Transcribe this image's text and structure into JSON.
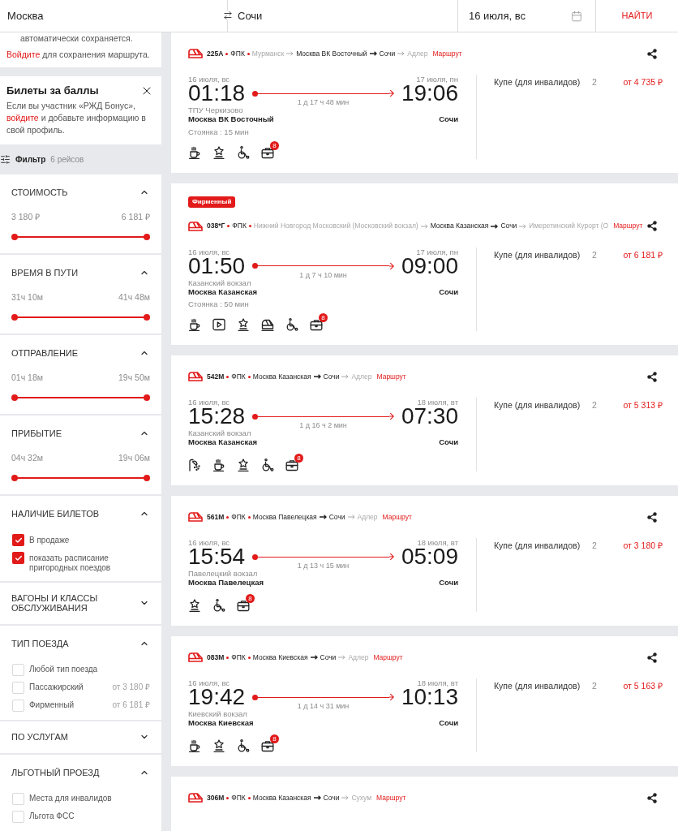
{
  "search": {
    "from": "Москва",
    "to": "Сочи",
    "date": "16 июля, вс",
    "submit": "НАЙТИ"
  },
  "sidebar": {
    "save_note": {
      "text": "автоматически сохраняется.",
      "link": "Войдите",
      "rest": "для сохранения маршрута."
    },
    "bonus": {
      "title": "Билеты за баллы",
      "before": "Если вы участник «РЖД Бонус»,",
      "link": "войдите",
      "after": "и добавьте информацию в свой профиль."
    },
    "filter": {
      "label": "Фильтр",
      "count": "6 рейсов"
    },
    "sections": [
      {
        "kind": "range",
        "title": "СТОИМОСТЬ",
        "expanded": true,
        "min": "3 180 ₽",
        "max": "6 181 ₽",
        "level": 1
      },
      {
        "kind": "range",
        "title": "ВРЕМЯ В ПУТИ",
        "expanded": true,
        "min": "31ч 10м",
        "max": "41ч 48м",
        "level": 1
      },
      {
        "kind": "range",
        "title": "ОТПРАВЛЕНИЕ",
        "expanded": true,
        "min": "01ч 18м",
        "max": "19ч 50м",
        "level": 1
      },
      {
        "kind": "range",
        "title": "ПРИБЫТИЕ",
        "expanded": true,
        "min": "04ч 32м",
        "max": "19ч 06м",
        "level": 1
      },
      {
        "kind": "checklist",
        "title": "НАЛИЧИЕ БИЛЕТОВ",
        "expanded": true,
        "options": [
          {
            "label": "В продаже",
            "checked": true
          },
          {
            "label": "показать расписание пригородных поездов",
            "checked": true
          }
        ]
      },
      {
        "kind": "checklist",
        "title": "ВАГОНЫ И КЛАССЫ ОБСЛУЖИВАНИЯ",
        "expanded": false
      },
      {
        "kind": "checklist",
        "title": "ТИП ПОЕЗДА",
        "expanded": true,
        "options": [
          {
            "label": "Любой тип поезда",
            "checked": false
          },
          {
            "label": "Пассажирский",
            "price": "от 3 180 ₽",
            "checked": false
          },
          {
            "label": "Фирменный",
            "price": "от 6 181 ₽",
            "checked": false
          }
        ]
      },
      {
        "kind": "checklist",
        "title": "ПО УСЛУГАМ",
        "expanded": false
      },
      {
        "kind": "checklist",
        "title": "ЛЬГОТНЫЙ ПРОЕЗД",
        "expanded": true,
        "options": [
          {
            "label": "Места для инвалидов",
            "checked": false
          },
          {
            "label": "Льгота ФСС",
            "checked": false
          }
        ]
      }
    ]
  },
  "trains": [
    {
      "number": "225А",
      "carrier": "ФПК",
      "route": [
        {
          "name": "Мурманск",
          "active": false
        },
        {
          "name": "Москва ВК Восточный",
          "active": true
        },
        {
          "name": "Сочи",
          "active": true
        },
        {
          "name": "Адлер",
          "active": false
        }
      ],
      "route_link": "Маршрут",
      "departure": {
        "date": "16 июля, вс",
        "time": "01:18",
        "station": "ТПУ Черкизово",
        "city": "Москва ВК Восточный"
      },
      "arrival": {
        "date": "17 июля, пн",
        "time": "19:06",
        "city": "Сочи"
      },
      "duration": "1 д 17 ч 48 мин",
      "stop": "Стоянка : 15 мин",
      "amenities": [
        {
          "kind": "coffee"
        },
        {
          "kind": "star"
        },
        {
          "kind": "wheelchair"
        },
        {
          "kind": "case",
          "badge": "8"
        }
      ],
      "fares": [
        {
          "class": "Купе (для инвалидов)",
          "seats": "2",
          "price": "от 4 735 ₽"
        }
      ]
    },
    {
      "badge": "Фирменный",
      "number": "038*Г",
      "carrier": "ФПК",
      "route": [
        {
          "name": "Нижний Новгород Московский (Московский вокзал)",
          "active": false
        },
        {
          "name": "Москва Казанская",
          "active": true
        },
        {
          "name": "Сочи",
          "active": true
        },
        {
          "name": "Имеретинский Курорт (О",
          "active": false
        }
      ],
      "route_link": "Маршрут",
      "departure": {
        "date": "16 июля, вс",
        "time": "01:50",
        "station": "Казанский вокзал",
        "city": "Москва Казанская"
      },
      "arrival": {
        "date": "17 июля, пн",
        "time": "09:00",
        "city": "Сочи"
      },
      "duration": "1 д 7 ч 10 мин",
      "stop": "Стоянка : 50 мин",
      "amenities": [
        {
          "kind": "coffee"
        },
        {
          "kind": "video"
        },
        {
          "kind": "star"
        },
        {
          "kind": "train"
        },
        {
          "kind": "wheelchair"
        },
        {
          "kind": "case",
          "badge": "8"
        }
      ],
      "fares": [
        {
          "class": "Купе (для инвалидов)",
          "seats": "2",
          "price": "от 6 181 ₽"
        }
      ]
    },
    {
      "number": "542М",
      "carrier": "ФПК",
      "route": [
        {
          "name": "Москва Казанская",
          "active": true
        },
        {
          "name": "Сочи",
          "active": true
        },
        {
          "name": "Адлер",
          "active": false
        }
      ],
      "route_link": "Маршрут",
      "departure": {
        "date": "16 июля, вс",
        "time": "15:28",
        "station": "Казанский вокзал",
        "city": "Москва Казанская"
      },
      "arrival": {
        "date": "18 июля, вт",
        "time": "07:30",
        "city": "Сочи"
      },
      "duration": "1 д 16 ч 2 мин",
      "amenities": [
        {
          "kind": "shower"
        },
        {
          "kind": "coffee"
        },
        {
          "kind": "star"
        },
        {
          "kind": "wheelchair"
        },
        {
          "kind": "case",
          "badge": "8"
        }
      ],
      "fares": [
        {
          "class": "Купе (для инвалидов)",
          "seats": "2",
          "price": "от 5 313 ₽"
        }
      ]
    },
    {
      "number": "561М",
      "carrier": "ФПК",
      "route": [
        {
          "name": "Москва Павелецкая",
          "active": true
        },
        {
          "name": "Сочи",
          "active": true
        },
        {
          "name": "Адлер",
          "active": false
        }
      ],
      "route_link": "Маршрут",
      "departure": {
        "date": "16 июля, вс",
        "time": "15:54",
        "station": "Павелецкий вокзал",
        "city": "Москва Павелецкая"
      },
      "arrival": {
        "date": "18 июля, вт",
        "time": "05:09",
        "city": "Сочи"
      },
      "duration": "1 д 13 ч 15 мин",
      "amenities": [
        {
          "kind": "star"
        },
        {
          "kind": "wheelchair"
        },
        {
          "kind": "case",
          "badge": "8"
        }
      ],
      "fares": [
        {
          "class": "Купе (для инвалидов)",
          "seats": "2",
          "price": "от 3 180 ₽"
        }
      ]
    },
    {
      "number": "083М",
      "carrier": "ФПК",
      "route": [
        {
          "name": "Москва Киевская",
          "active": true
        },
        {
          "name": "Сочи",
          "active": true
        },
        {
          "name": "Адлер",
          "active": false
        }
      ],
      "route_link": "Маршрут",
      "departure": {
        "date": "16 июля, вс",
        "time": "19:42",
        "station": "Киевский вокзал",
        "city": "Москва Киевская"
      },
      "arrival": {
        "date": "18 июля, вт",
        "time": "10:13",
        "city": "Сочи"
      },
      "duration": "1 д 14 ч 31 мин",
      "amenities": [
        {
          "kind": "coffee"
        },
        {
          "kind": "star"
        },
        {
          "kind": "wheelchair"
        },
        {
          "kind": "case",
          "badge": "8"
        }
      ],
      "fares": [
        {
          "class": "Купе (для инвалидов)",
          "seats": "2",
          "price": "от 5 163 ₽"
        }
      ]
    },
    {
      "number": "306М",
      "carrier": "ФПК",
      "route": [
        {
          "name": "Москва Казанская",
          "active": true
        },
        {
          "name": "Сочи",
          "active": true
        },
        {
          "name": "Сухум",
          "active": false
        }
      ],
      "route_link": "Маршрут"
    }
  ]
}
